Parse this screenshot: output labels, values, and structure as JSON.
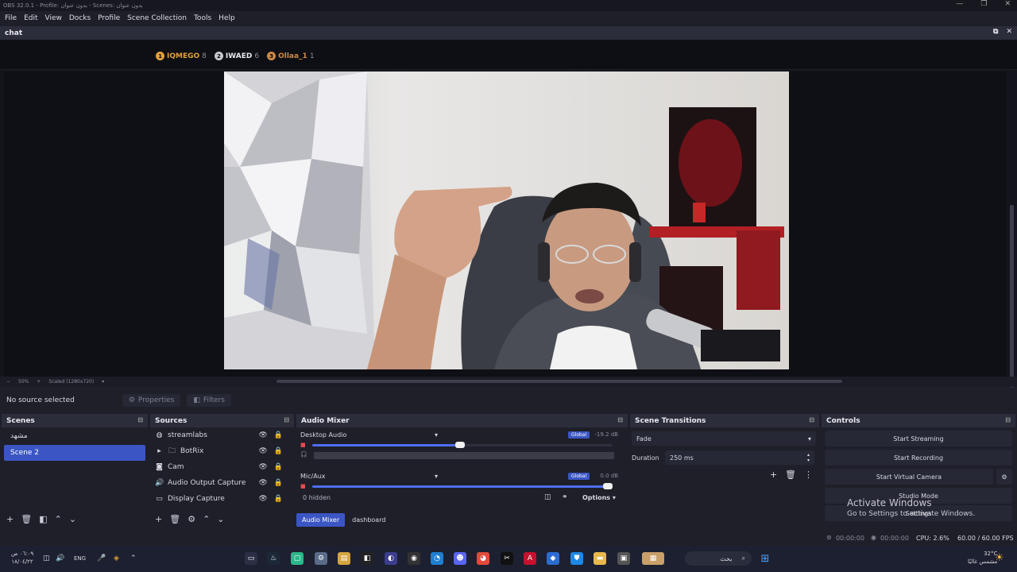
{
  "window": {
    "title": "OBS 32.0.1 - Profile: بدون عنوان - Scenes: بدون عنوان",
    "minimize": "—",
    "restore": "❐",
    "close": "✕"
  },
  "menu": [
    "File",
    "Edit",
    "View",
    "Docks",
    "Profile",
    "Scene Collection",
    "Tools",
    "Help"
  ],
  "chat_dock": {
    "title": "chat",
    "leaderboard": [
      {
        "rank": "1",
        "name": "IQMEGO",
        "count": "8",
        "color": "#e0a23a"
      },
      {
        "rank": "2",
        "name": "IWAED",
        "count": "6",
        "color": "#c8c8d2"
      },
      {
        "rank": "3",
        "name": "Ollaa_1",
        "count": "1",
        "color": "#c98a4a"
      }
    ]
  },
  "zoom": {
    "minus": "−",
    "value": "50%",
    "plus": "+",
    "scale": "Scaled (1280x720)"
  },
  "props_bar": {
    "status": "No source selected",
    "properties_label": "Properties",
    "filters_label": "Filters"
  },
  "scenes": {
    "title": "Scenes",
    "items": [
      "مشهد",
      "Scene 2"
    ],
    "active_index": 1
  },
  "sources": {
    "title": "Sources",
    "items": [
      {
        "label": "streamlabs",
        "icon": "globe-icon"
      },
      {
        "label": "BotRix",
        "icon": "folder-icon"
      },
      {
        "label": "Cam",
        "icon": "camera-icon"
      },
      {
        "label": "Audio Output Capture",
        "icon": "speaker-icon"
      },
      {
        "label": "Display Capture",
        "icon": "monitor-icon"
      }
    ]
  },
  "audio_mixer": {
    "title": "Audio Mixer",
    "tracks": [
      {
        "name": "Desktop Audio",
        "global": "Global",
        "db": "-19.2 dB",
        "level": 0.5
      },
      {
        "name": "Mic/Aux",
        "global": "Global",
        "db": "0.0 dB",
        "level": 1.0
      }
    ],
    "ticks": [
      "-60",
      "-55",
      "-50",
      "-45",
      "-40",
      "-35",
      "-30",
      "-25",
      "-20",
      "-15",
      "-10",
      "-5",
      "0"
    ],
    "hidden": "0 hidden",
    "options": "Options",
    "tabs": [
      "Audio Mixer",
      "dashboard"
    ]
  },
  "transitions": {
    "title": "Scene Transitions",
    "type": "Fade",
    "duration_label": "Duration",
    "duration_value": "250 ms"
  },
  "controls": {
    "title": "Controls",
    "buttons": [
      "Start Streaming",
      "Start Recording",
      "Start Virtual Camera",
      "Studio Mode",
      "Settings"
    ]
  },
  "watermark": {
    "line1": "Activate Windows",
    "line2": "Go to Settings to activate Windows."
  },
  "status": {
    "stream_time": "00:00:00",
    "rec_time": "00:00:00",
    "cpu": "CPU: 2.6%",
    "fps": "60.00 / 60.00 FPS"
  },
  "taskbar": {
    "time": "٠٦:٠٩ ص",
    "date": "١٨/٠٤/٢٢",
    "lang": "ENG",
    "search": "بحث",
    "temp": "32°C",
    "weather": "مشمس غالبًا"
  },
  "colors": {
    "accent": "#3b56c4",
    "panel": "#1e1f29",
    "header": "#2b2d3a"
  }
}
